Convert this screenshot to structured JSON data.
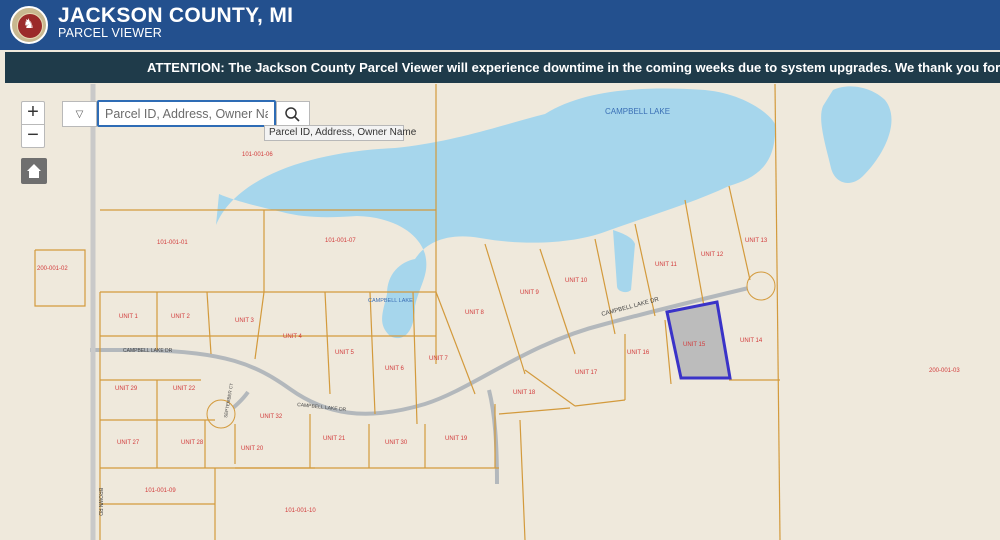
{
  "header": {
    "title": "JACKSON COUNTY, MI",
    "subtitle": "PARCEL VIEWER",
    "logo_glyph": "♞"
  },
  "banner": {
    "text": "ATTENTION: The Jackson County Parcel Viewer will experience downtime in the coming weeks due to system upgrades. We thank you for your patie"
  },
  "toolbar": {
    "zoom_in": "+",
    "zoom_out": "−",
    "dropdown_glyph": "▽",
    "search_placeholder": "Parcel ID, Address, Owner Name",
    "tooltip": "Parcel ID, Address, Owner Name"
  },
  "colors": {
    "parcel_line": "#d39a3c",
    "water": "#a6d6ec",
    "road": "#b3b8bc",
    "label_red": "#d23b3b",
    "selected_fill": "#bcbcbc",
    "selected_outline": "#3a33c8",
    "header_bg": "#23508e"
  },
  "map": {
    "lake_labels": [
      "CAMPBELL LAKE",
      "CAMPBELL LAKE"
    ],
    "road_labels": [
      "CAMPBELL LAKE DR",
      "CAMPBELL LAKE DR",
      "CAMPBELL LAKE DR",
      "BROWN RD",
      "SEPTEMBER CT"
    ],
    "parcels": [
      "101-001-06",
      "101-001-01",
      "101-001-07",
      "200-001-02",
      "UNIT 1",
      "UNIT 2",
      "UNIT 3",
      "UNIT 4",
      "UNIT 5",
      "UNIT 6",
      "UNIT 7",
      "UNIT 8",
      "UNIT 9",
      "UNIT 10",
      "UNIT 11",
      "UNIT 12",
      "UNIT 13",
      "UNIT 14",
      "UNIT 15",
      "UNIT 16",
      "UNIT 17",
      "UNIT 18",
      "UNIT 19",
      "UNIT 20",
      "UNIT 21",
      "UNIT 22",
      "UNIT 27",
      "UNIT 28",
      "UNIT 29",
      "UNIT 30",
      "UNIT 32",
      "101-001-09",
      "101-001-10",
      "200-001-03"
    ]
  }
}
